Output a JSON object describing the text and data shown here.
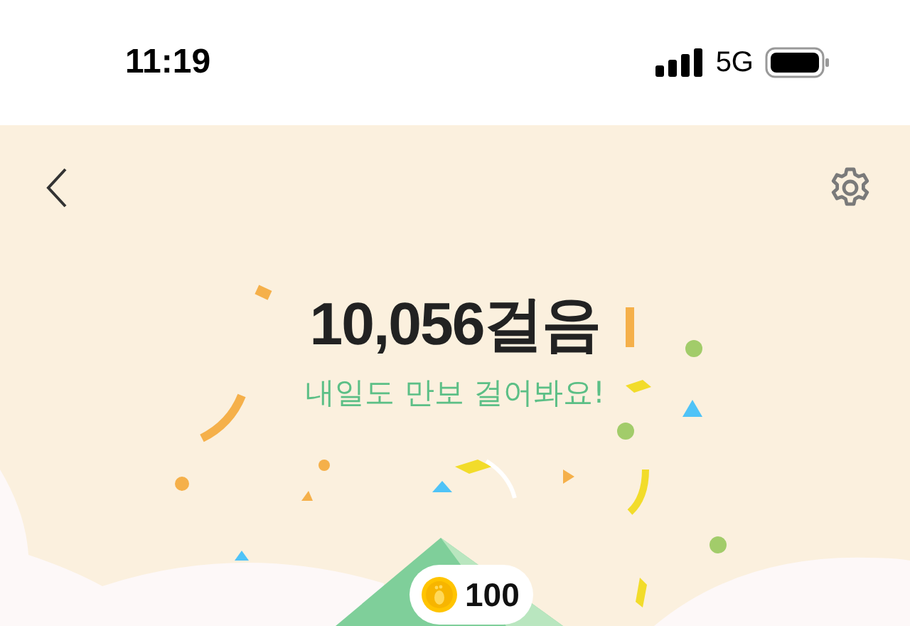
{
  "status_bar": {
    "time": "11:19",
    "network": "5G"
  },
  "steps": {
    "count": "10,056걸음",
    "message": "내일도 만보 걸어봐요!"
  },
  "reward": {
    "amount": "100"
  }
}
